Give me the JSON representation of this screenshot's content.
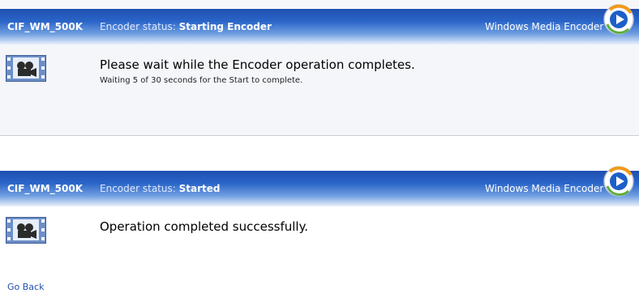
{
  "panels": [
    {
      "profile_name": "CIF_WM_500K",
      "status_prefix": "Encoder status: ",
      "status_value": "Starting Encoder",
      "brand": "Windows Media Encoder",
      "message": "Please wait while the Encoder operation completes.",
      "submessage": "Waiting 5 of 30 seconds for the Start to complete."
    },
    {
      "profile_name": "CIF_WM_500K",
      "status_prefix": "Encoder status: ",
      "status_value": "Started",
      "brand": "Windows Media Encoder",
      "message": "Operation completed successfully."
    }
  ],
  "footer": {
    "go_back": "Go Back"
  },
  "icons": {
    "logo": "windows-media-encoder-play-icon",
    "app": "film-camera-icon"
  },
  "colors": {
    "header_dark": "#1f4fb0",
    "header_light": "#eaf1fb",
    "logo_blue": "#1d5fc9",
    "logo_orange": "#f29a1c",
    "link": "#1f4fb0"
  }
}
